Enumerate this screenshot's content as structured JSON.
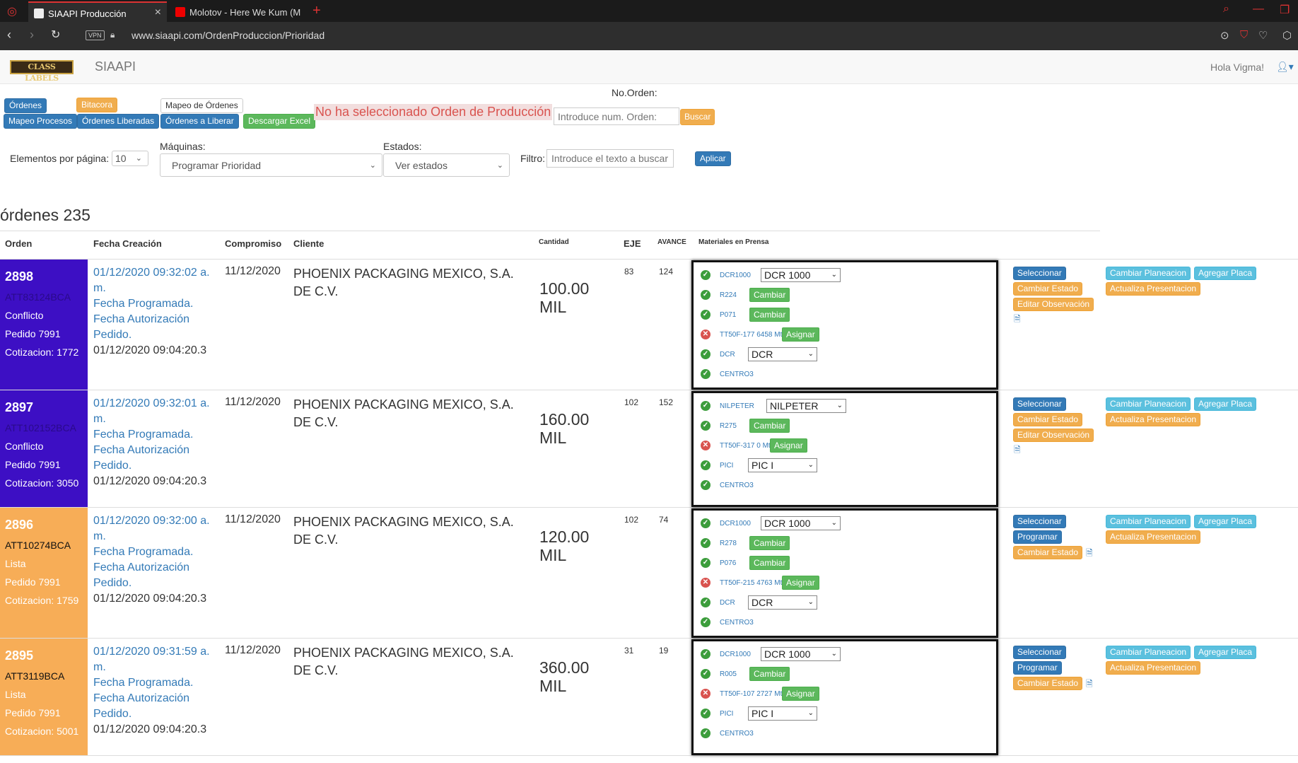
{
  "browser": {
    "tabs": [
      {
        "title": "SIAAPI Producción"
      },
      {
        "title": "Molotov - Here We Kum (M"
      }
    ],
    "vpn_badge": "VPN",
    "url": "www.siaapi.com/OrdenProduccion/Prioridad"
  },
  "app": {
    "logo_text": "CLASS LABELS",
    "brand": "SIAAPI",
    "greeting": "Hola Vigma!"
  },
  "toolbar": {
    "ordenes": "Órdenes",
    "mapeo_procesos": "Mapeo Procesos",
    "bitacora": "Bitacora",
    "ordenes_liberadas": "Órdenes Liberadas",
    "mapeo_ordenes": "Mapeo de Órdenes",
    "ordenes_liberar": "Órdenes a Liberar",
    "descargar_excel": "Descargar Excel",
    "warning": "No ha seleccionado Orden de Producción",
    "no_orden_label": "No.Orden:",
    "no_orden_placeholder": "Introduce num. Orden:",
    "buscar": "Buscar"
  },
  "filters": {
    "elementos_label": "Elementos por página:",
    "elementos_value": "10",
    "maquinas_label": "Máquinas:",
    "maquinas_value": "Programar Prioridad",
    "estados_label": "Estados:",
    "estados_value": "Ver estados",
    "filtro_label": "Filtro:",
    "filtro_placeholder": "Introduce el texto a buscar",
    "aplicar": "Aplicar"
  },
  "count_title": "órdenes 235",
  "columns": {
    "orden": "Orden",
    "fecha": "Fecha Creación",
    "compromiso": "Compromiso",
    "cliente": "Cliente",
    "cantidad": "Cantidad",
    "eje": "EJE",
    "avance": "AVANCE",
    "materiales": "Materiales en Prensa"
  },
  "colors": {
    "conflicto": "#3d0fc4",
    "lista": "#f7ad57",
    "primary": "#337ab7"
  },
  "rows": [
    {
      "num": "2898",
      "code": "ATT83124BCA",
      "status": "Conflicto",
      "pedido": "Pedido 7991",
      "cotizacion": "Cotizacion: 1772",
      "fecha": "01/12/2020 09:32:02 a. m.",
      "fecha_prog": "Fecha Programada.",
      "fecha_aut": "Fecha Autorización Pedido.",
      "fecha_val": "01/12/2020 09:04:20.3",
      "compromiso": "11/12/2020",
      "cliente": "PHOENIX PACKAGING MEXICO, S.A. DE C.V.",
      "cantidad": "100.00",
      "unidad": "MIL",
      "eje": "83",
      "avance": "124",
      "mat": [
        {
          "code": "DCR1000",
          "select": "DCR 1000"
        },
        {
          "code": "R224",
          "btn": "Cambiar"
        },
        {
          "code": "P071",
          "btn": "Cambiar"
        },
        {
          "code": "TT50F-177 6458 Mts",
          "btn": "Asignar"
        },
        {
          "code": "DCR",
          "select": "DCR"
        },
        {
          "code": "CENTRO3"
        }
      ],
      "b_sel": "Seleccionar",
      "b_estado": "Cambiar Estado",
      "b_obs": "Editar Observación",
      "b_plan": "Cambiar Planeacion",
      "b_placa": "Agregar Placa",
      "b_pres": "Actualiza Presentacion"
    },
    {
      "num": "2897",
      "code": "ATT102152BCA",
      "status": "Conflicto",
      "pedido": "Pedido 7991",
      "cotizacion": "Cotizacion: 3050",
      "fecha": "01/12/2020 09:32:01 a. m.",
      "fecha_prog": "Fecha Programada.",
      "fecha_aut": "Fecha Autorización Pedido.",
      "fecha_val": "01/12/2020 09:04:20.3",
      "compromiso": "11/12/2020",
      "cliente": "PHOENIX PACKAGING MEXICO, S.A. DE C.V.",
      "cantidad": "160.00",
      "unidad": "MIL",
      "eje": "102",
      "avance": "152",
      "mat": [
        {
          "code": "NILPETER",
          "select": "NILPETER"
        },
        {
          "code": "R275",
          "btn": "Cambiar"
        },
        {
          "code": "TT50F-317 0 Mts",
          "btn": "Asignar"
        },
        {
          "code": "PICI",
          "select": "PIC I"
        },
        {
          "code": "CENTRO3"
        }
      ],
      "b_sel": "Seleccionar",
      "b_estado": "Cambiar Estado",
      "b_obs": "Editar Observación",
      "b_plan": "Cambiar Planeacion",
      "b_placa": "Agregar Placa",
      "b_pres": "Actualiza Presentacion"
    },
    {
      "num": "2896",
      "code": "ATT10274BCA",
      "status": "Lista",
      "pedido": "Pedido 7991",
      "cotizacion": "Cotizacion: 1759",
      "fecha": "01/12/2020 09:32:00 a. m.",
      "fecha_prog": "Fecha Programada.",
      "fecha_aut": "Fecha Autorización Pedido.",
      "fecha_val": "01/12/2020 09:04:20.3",
      "compromiso": "11/12/2020",
      "cliente": "PHOENIX PACKAGING MEXICO, S.A. DE C.V.",
      "cantidad": "120.00",
      "unidad": "MIL",
      "eje": "102",
      "avance": "74",
      "mat": [
        {
          "code": "DCR1000",
          "select": "DCR 1000"
        },
        {
          "code": "R278",
          "btn": "Cambiar"
        },
        {
          "code": "P076",
          "btn": "Cambiar"
        },
        {
          "code": "TT50F-215 4763 Mts",
          "btn": "Asignar"
        },
        {
          "code": "DCR",
          "select": "DCR"
        },
        {
          "code": "CENTRO3"
        }
      ],
      "b_sel": "Seleccionar",
      "b_prog": "Programar",
      "b_estado": "Cambiar Estado",
      "b_plan": "Cambiar Planeacion",
      "b_placa": "Agregar Placa",
      "b_pres": "Actualiza Presentacion"
    },
    {
      "num": "2895",
      "code": "ATT3119BCA",
      "status": "Lista",
      "pedido": "Pedido 7991",
      "cotizacion": "Cotizacion: 5001",
      "fecha": "01/12/2020 09:31:59 a. m.",
      "fecha_prog": "Fecha Programada.",
      "fecha_aut": "Fecha Autorización Pedido.",
      "fecha_val": "01/12/2020 09:04:20.3",
      "compromiso": "11/12/2020",
      "cliente": "PHOENIX PACKAGING MEXICO, S.A. DE C.V.",
      "cantidad": "360.00",
      "unidad": "MIL",
      "eje": "31",
      "avance": "19",
      "mat": [
        {
          "code": "DCR1000",
          "select": "DCR 1000"
        },
        {
          "code": "R005",
          "btn": "Cambiar"
        },
        {
          "code": "TT50F-107 2727 Mts",
          "btn": "Asignar"
        },
        {
          "code": "PICI",
          "select": "PIC I"
        },
        {
          "code": "CENTRO3"
        }
      ],
      "b_sel": "Seleccionar",
      "b_prog": "Programar",
      "b_estado": "Cambiar Estado",
      "b_plan": "Cambiar Planeacion",
      "b_placa": "Agregar Placa",
      "b_pres": "Actualiza Presentacion"
    }
  ]
}
